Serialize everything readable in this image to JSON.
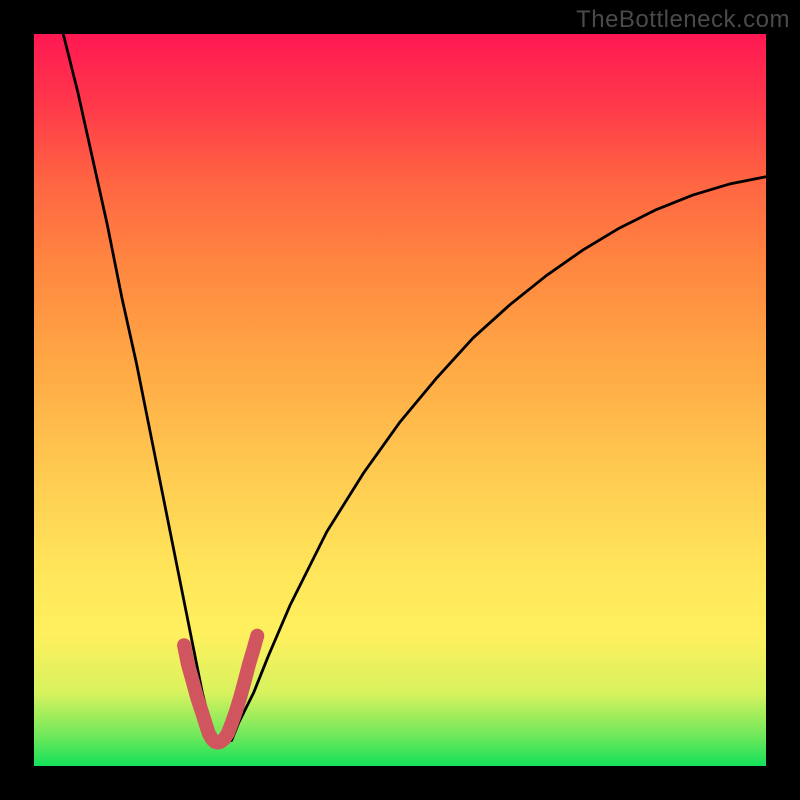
{
  "watermark": "TheBottleneck.com",
  "chart_data": {
    "type": "line",
    "title": "",
    "xlabel": "",
    "ylabel": "",
    "xlim": [
      0,
      100
    ],
    "ylim": [
      0,
      100
    ],
    "series": [
      {
        "name": "curve",
        "x": [
          4,
          6,
          8,
          10,
          12,
          14,
          16,
          18,
          20,
          22,
          23,
          24,
          25,
          26,
          27,
          28,
          30,
          32,
          35,
          40,
          45,
          50,
          55,
          60,
          65,
          70,
          75,
          80,
          85,
          90,
          95,
          100
        ],
        "values": [
          100,
          92,
          83,
          74,
          64,
          55,
          45,
          35,
          25,
          15,
          10,
          6,
          3.5,
          3.2,
          3.5,
          6,
          10,
          15,
          22,
          32,
          40,
          47,
          53,
          58.5,
          63,
          67,
          70.5,
          73.5,
          76,
          78,
          79.5,
          80.5
        ]
      },
      {
        "name": "marker",
        "x": [
          20.5,
          21,
          21.7,
          22.3,
          23,
          23.5,
          23.9,
          24.3,
          24.7,
          25.1,
          25.5,
          26,
          26.5,
          27,
          27.6,
          28.2,
          28.8,
          29.4,
          30,
          30.5
        ],
        "values": [
          16.5,
          14,
          11.5,
          9.3,
          7.2,
          5.6,
          4.4,
          3.7,
          3.3,
          3.2,
          3.3,
          3.7,
          4.5,
          5.8,
          7.5,
          9.5,
          11.7,
          14,
          16,
          17.8
        ]
      }
    ],
    "marker_color": "#d1555f",
    "curve_color": "#000000"
  }
}
